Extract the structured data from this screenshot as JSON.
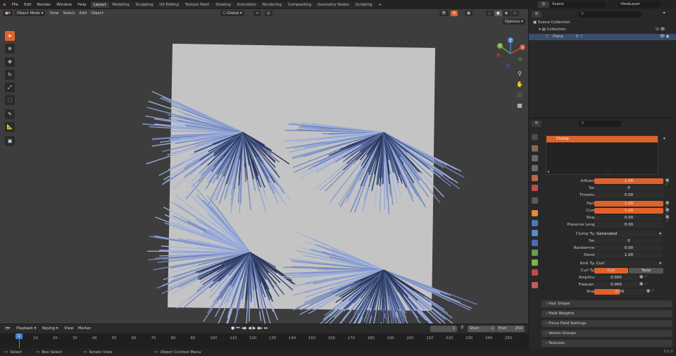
{
  "topbar": {
    "menus": [
      "File",
      "Edit",
      "Render",
      "Window",
      "Help"
    ],
    "workspaces": [
      "Layout",
      "Modeling",
      "Sculpting",
      "UV Editing",
      "Texture Paint",
      "Shading",
      "Animation",
      "Rendering",
      "Compositing",
      "Geometry Nodes",
      "Scripting"
    ],
    "add_tab": "+",
    "scene_label": "Scene",
    "viewlayer_label": "ViewLayer"
  },
  "viewport": {
    "mode": "Object Mode",
    "menus": [
      "View",
      "Select",
      "Add",
      "Object"
    ],
    "transform": "Global",
    "options": "Options",
    "gizmo": {
      "x": "X",
      "y": "Y",
      "z": "Z"
    }
  },
  "outliner": {
    "search_placeholder": "",
    "items": [
      "Scene Collection",
      "Collection",
      "Plane"
    ]
  },
  "properties": {
    "clump_item": "Clump",
    "rows": [
      {
        "label": "Influence",
        "value": "1.00",
        "style": "orange"
      },
      {
        "label": "Seed",
        "value": "0",
        "style": "dark"
      },
      {
        "label": "Threshold",
        "value": "0.00",
        "style": "dark"
      },
      {
        "label": "Factor",
        "value": "1.00",
        "style": "orange"
      },
      {
        "label": "Clump",
        "value": "1.00",
        "style": "orange"
      },
      {
        "label": "Shape",
        "value": "0.00",
        "style": "dark"
      },
      {
        "label": "Preserve Length",
        "value": "0.00",
        "style": "dark"
      }
    ],
    "clump_type_label": "Clump Type",
    "clump_type_value": "Generated",
    "rows2": [
      {
        "label": "Seed",
        "value": "0"
      },
      {
        "label": "Randomness",
        "value": "0.00"
      },
      {
        "label": "Density",
        "value": "1.00"
      }
    ],
    "kink_type_label": "Kink Type",
    "kink_type_value": "Curl",
    "curl_type_label": "Curl Type",
    "curl_options": [
      "Curl",
      "Twist"
    ],
    "amplitude_label": "Amplitude",
    "amplitude_value": "0.000",
    "frequency_label": "Frequency",
    "frequency_value": "0.000",
    "shape_label": "Shape",
    "shape_value": "0.00",
    "shape_fill": 0.5,
    "panels": [
      "Hair Shape",
      "Field Weights",
      "Force Field Settings",
      "Vertex Groups",
      "Textures"
    ]
  },
  "timeline": {
    "menus": [
      "Playback",
      "Keying",
      "View",
      "Marker"
    ],
    "current_frame": "1",
    "start_label": "Start",
    "start_value": "1",
    "end_label": "End",
    "end_value": "250",
    "ticks": [
      "10",
      "20",
      "30",
      "40",
      "50",
      "60",
      "70",
      "80",
      "90",
      "100",
      "110",
      "120",
      "130",
      "140",
      "150",
      "160",
      "170",
      "180",
      "190",
      "200",
      "210",
      "220",
      "230",
      "240",
      "250"
    ],
    "frame_marker": "1"
  },
  "statusbar": {
    "items": [
      "Select",
      "Box Select",
      "Rotate View",
      "Object Context Menu"
    ],
    "version": "3.0.0"
  },
  "colors": {
    "accent": "#e0622b",
    "hair": "#8a9fd0",
    "plane": "#c4c4c4"
  }
}
